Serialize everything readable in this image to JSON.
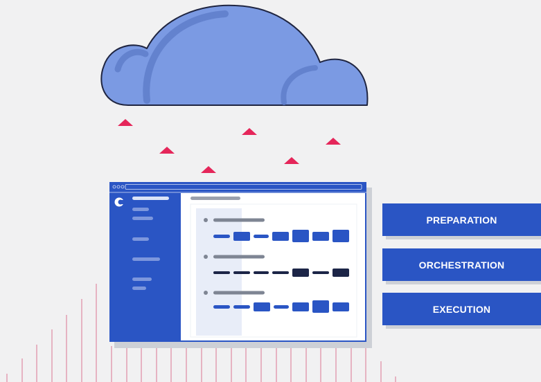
{
  "stages": [
    {
      "label": "PREPARATION"
    },
    {
      "label": "ORCHESTRATION"
    },
    {
      "label": "EXECUTION"
    }
  ],
  "colors": {
    "background": "#f1f1f2",
    "cloud_fill": "#7b9ae3",
    "cloud_stroke": "#1f2541",
    "arrow": "#e5265a",
    "brand_blue": "#2a55c4",
    "dark_navy": "#1c2547",
    "rain_lines": "#e08aa3"
  },
  "icons": {
    "cloud": "cloud-icon",
    "arrows": "upload-arrow-icon",
    "logo": "app-logo-icon"
  }
}
